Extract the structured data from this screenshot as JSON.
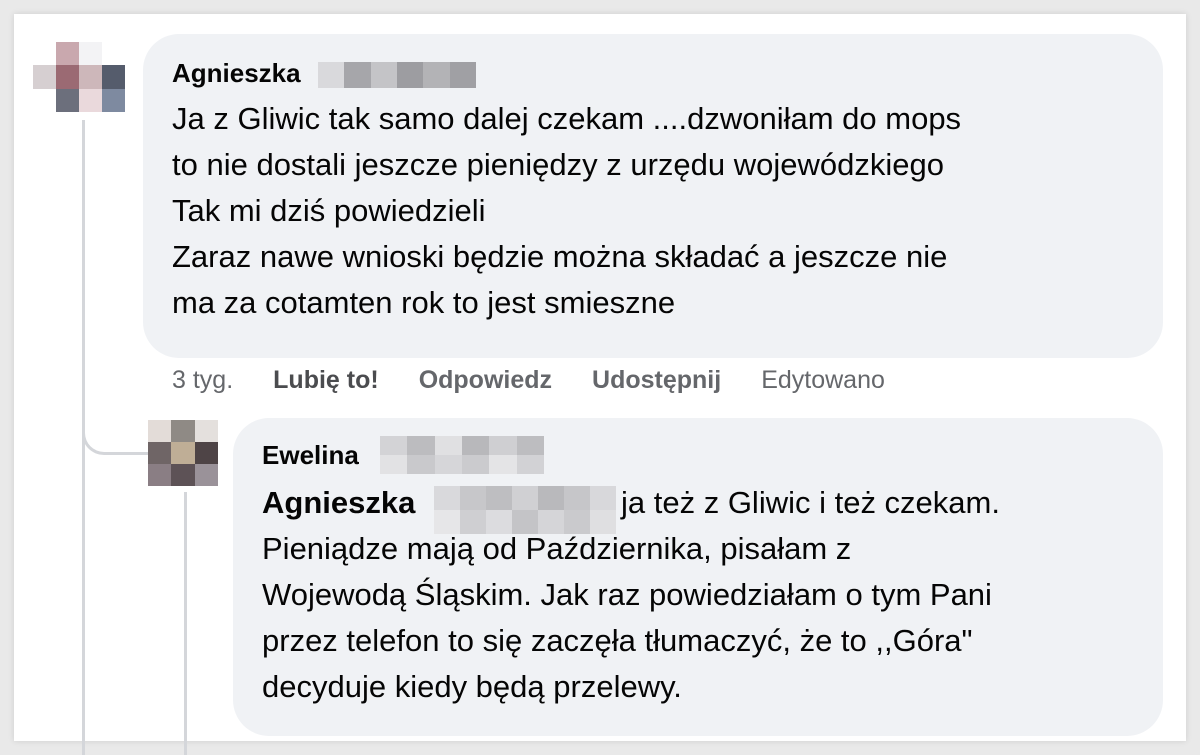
{
  "comment": {
    "author": "Agnieszka",
    "lines": [
      "Ja z Gliwic tak samo dalej czekam ....dzwoniłam do mops",
      "to nie dostali jeszcze pieniędzy z urzędu wojewódzkiego",
      "Tak mi dziś powiedzieli",
      "Zaraz nawe wnioski będzie można składać a jeszcze nie",
      "ma za cotamten rok to jest smieszne"
    ],
    "actions": {
      "time": "3 tyg.",
      "like": "Lubię to!",
      "reply": "Odpowiedz",
      "share": "Udostępnij",
      "edited": "Edytowano"
    }
  },
  "reply": {
    "author": "Ewelina",
    "mention": "Agnieszka",
    "first_line_rest": "ja też z Gliwic i też czekam.",
    "lines": [
      "Pieniądze mają od Października, pisałam z",
      "Wojewodą Śląskim. Jak raz powiedziałam o tym Pani",
      "przez telefon to się zaczęła tłumaczyć, że to ,,Góra\"",
      "decyduje kiedy będą przelewy."
    ]
  },
  "colors": {
    "bubble": "#f0f2f5",
    "secondary_text": "#65676b",
    "thread_line": "#d4d6da"
  }
}
